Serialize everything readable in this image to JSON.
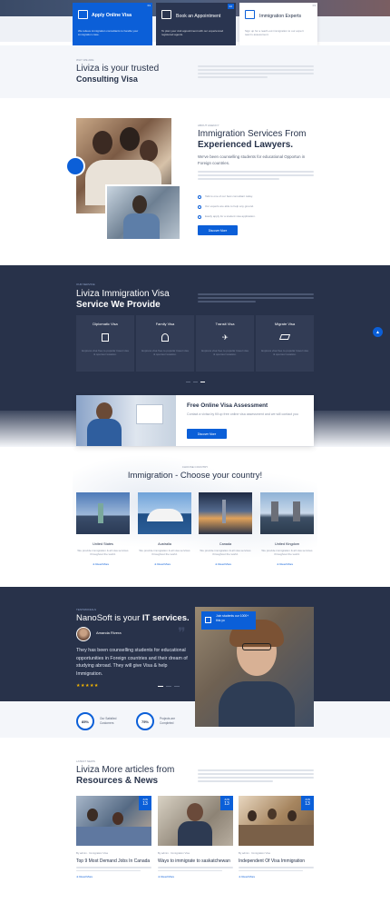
{
  "top_cards": [
    {
      "title": "Apply Online Visa",
      "num": "01",
      "text": "We relieve immigration consultants to handle your immigration case."
    },
    {
      "title": "Book an Appointment",
      "num": "02",
      "text": "To plan your visit appointment with our experienced registered agents."
    },
    {
      "title": "Immigration Experts",
      "num": "03",
      "text": "Sign up for a reach-out immigration to our expert team's assessment."
    }
  ],
  "trusted": {
    "kicker": "WHY WE ARE",
    "line1": "Liviza is your trusted",
    "line2": "Consulting Visa"
  },
  "services": {
    "kicker": "ABOUT AGENCY",
    "line1": "Immigration Services From",
    "line2": "Experienced Lawyers.",
    "lead": "We've been counselling students for educational Opportun in Foreign countries.",
    "checks": [
      "Talk to one of our best consultant today.",
      "Our experts are able to help any ground.",
      "Easily apply for a student visa application."
    ],
    "button": "Discover More"
  },
  "dark": {
    "kicker": "OUR SERVICE",
    "line1": "Liviza Immigration Visa",
    "line2": "Service We Provide",
    "cards": [
      {
        "title": "Diplomatic Visa",
        "icon": "passport-icon"
      },
      {
        "title": "Family Visa",
        "icon": "family-icon"
      },
      {
        "title": "Transit Visa",
        "icon": "airplane-icon"
      },
      {
        "title": "Migrate Visa",
        "icon": "graduation-icon"
      }
    ],
    "card_text": "Express visa free to popular travel visa & sponsor location."
  },
  "assessment": {
    "title": "Free Online Visa Assessment",
    "text": "Contact a vivisa by fill up free online visa assessment and we will contact you",
    "button": "Discover More"
  },
  "countries": {
    "kicker": "CHOOSE COUNTRY",
    "title": "Immigration - Choose your country!",
    "items": [
      {
        "name": "United States"
      },
      {
        "name": "Australia"
      },
      {
        "name": "Canada"
      },
      {
        "name": "United Kingdom"
      }
    ],
    "item_text": "We provide immigration & all visa services throughout the world.",
    "link": "Read More"
  },
  "testimonials": {
    "kicker": "TESTIMONIALS",
    "title_a": "NanoSoft is your ",
    "title_b": "IT services.",
    "name": "Amanda Rivera",
    "quote": "They has been counselling students for educational opportunities in Foreign countries and their dream of studying abroad. They will give Visa & help Immigration.",
    "stars": "★★★★★",
    "badge": "Join students our 1000+ this yo",
    "stat1_value": "85%",
    "stat1_label": "Our Satisfied Customers",
    "stat2_value": "75%",
    "stat2_label": "Projects are Completed"
  },
  "news": {
    "kicker": "LATEST NEWS",
    "line1": "Liviza More articles from",
    "line2": "Resources & News",
    "posts": [
      {
        "day": "13",
        "mon": "JUN",
        "title": "Top 9 Most Demand Jobs In Canada",
        "meta": "By admin · Immigration Visa"
      },
      {
        "day": "13",
        "mon": "JUN",
        "title": "Ways to immigrate to saskatchewan",
        "meta": "By admin · Immigration Visa"
      },
      {
        "day": "13",
        "mon": "JUN",
        "title": "Independent Of Visa Immigration",
        "meta": "By admin · Immigration Visa"
      }
    ],
    "link": "Read More"
  },
  "colors": {
    "primary": "#0b5fd8",
    "dark": "#28324a",
    "light_bg": "#f4f6fa"
  }
}
